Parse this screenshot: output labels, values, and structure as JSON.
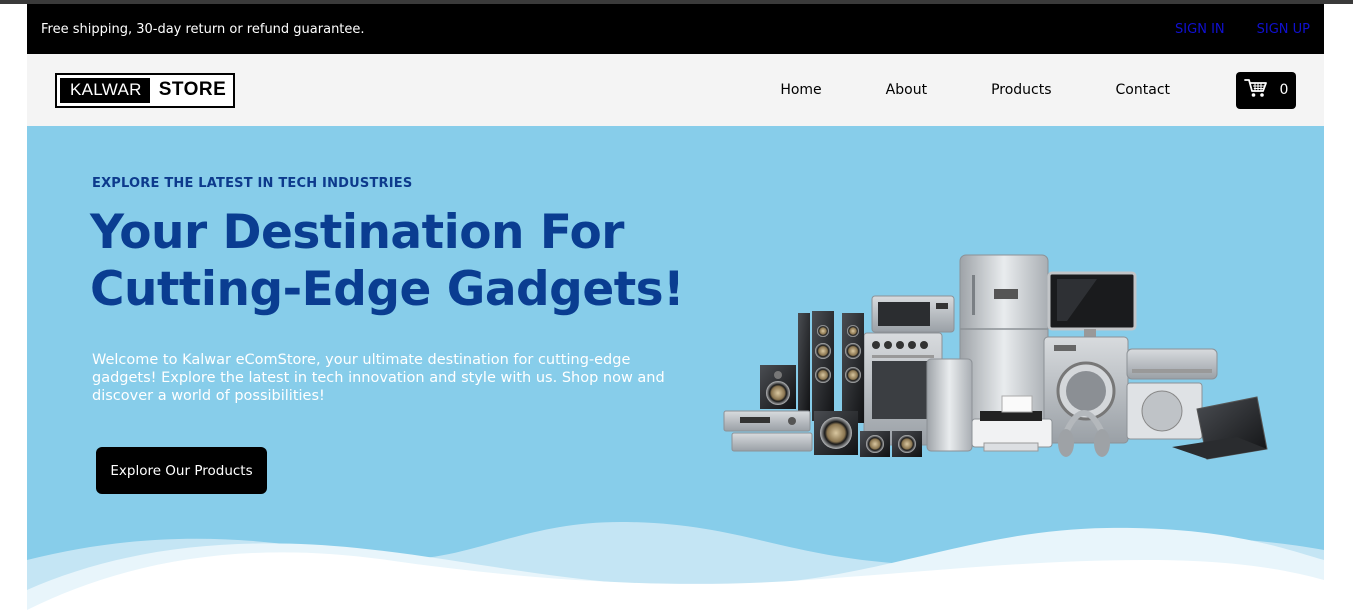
{
  "announcement": {
    "text": "Free shipping, 30-day return or refund guarantee.",
    "sign_in": "SIGN IN",
    "sign_up": "SIGN UP"
  },
  "navbar": {
    "logo_left": "KALWAR",
    "logo_right": "STORE",
    "links": [
      "Home",
      "About",
      "Products",
      "Contact"
    ],
    "cart_count": "0"
  },
  "hero": {
    "kicker": "EXPLORE THE LATEST IN TECH INDUSTRIES",
    "title": "Your Destination For Cutting-Edge Gadgets!",
    "description": "Welcome to Kalwar eComStore, your ultimate destination for cutting-edge gadgets! Explore the latest in tech innovation and style with us. Shop now and discover a world of possibilities!",
    "cta": "Explore Our Products"
  },
  "colors": {
    "hero_bg": "#87cdea",
    "heading": "#0a3d91",
    "auth_link": "#1010d0",
    "topbar": "#000000"
  },
  "icons": {
    "cart": "shopping-cart-icon",
    "hero_image": "electronics-appliances-illustration"
  }
}
